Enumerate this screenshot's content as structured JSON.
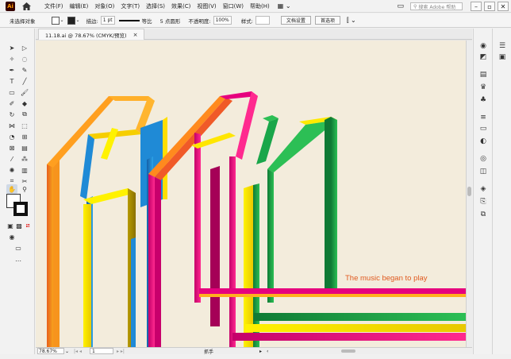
{
  "app": {
    "logo": "Ai",
    "menu": [
      "文件(F)",
      "编辑(E)",
      "对象(O)",
      "文字(T)",
      "选择(S)",
      "效果(C)",
      "视图(V)",
      "窗口(W)",
      "帮助(H)"
    ],
    "search_placeholder": "搜索 Adobe 帮助"
  },
  "control_bar": {
    "selection_label": "未选择对象",
    "stroke_label": "描边:",
    "stroke_weight": "1 pt",
    "stroke_profile": "等比",
    "brush": "5 点圆形",
    "opacity_label": "不透明度:",
    "opacity_value": "100%",
    "style_label": "样式:",
    "doc_setup_button": "文档设置",
    "prefs_button": "首选项"
  },
  "document": {
    "tab_title": "11.18.ai @ 78.67% (CMYK/预览)",
    "tab_close": "×",
    "zoom": "78.67%",
    "page": "1",
    "status": "抓手"
  },
  "artwork": {
    "caption": "The music began to play",
    "colors": {
      "background": "#f3ecdc",
      "orange": "#f7941d",
      "yellow": "#fff200",
      "magenta": "#e6007e",
      "green": "#1aa64a",
      "blue": "#1f8ad6"
    }
  }
}
